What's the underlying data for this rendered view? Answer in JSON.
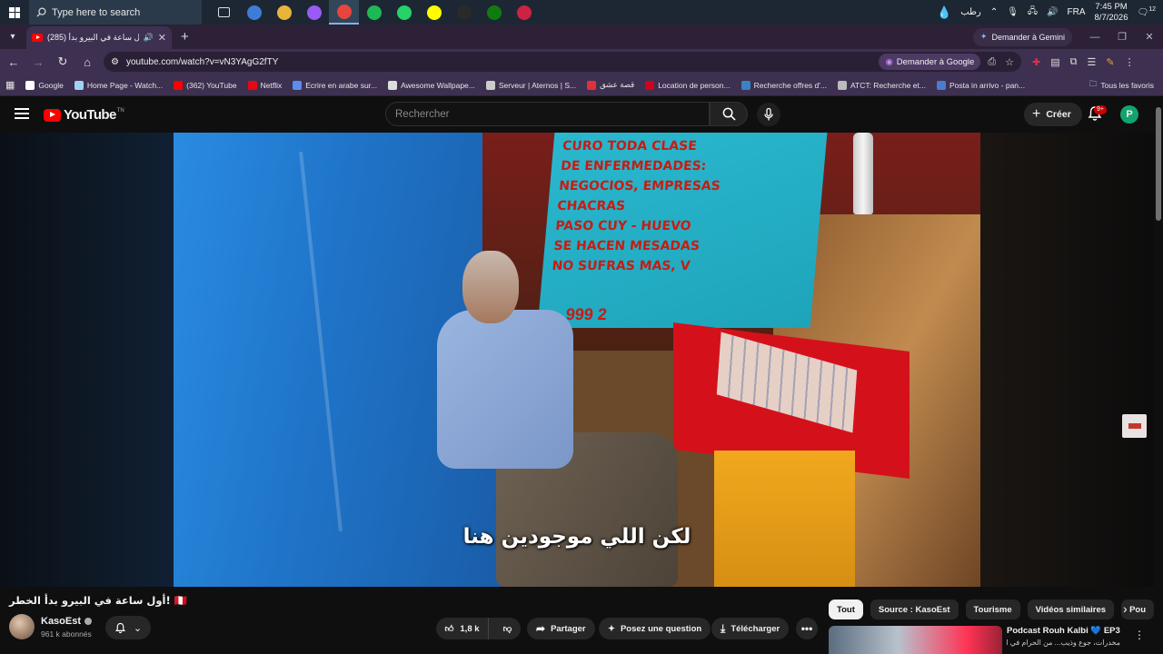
{
  "taskbar": {
    "search_placeholder": "Type here to search",
    "weather_text": "رطب",
    "language": "FRA",
    "time": "7:45 PM",
    "date": "8/7/2026",
    "notification_count": "12",
    "apps": [
      {
        "icon": "task-view-icon",
        "color": "#1d2733"
      },
      {
        "icon": "office-icon",
        "color": "#3d7dd8"
      },
      {
        "icon": "file-explorer-icon",
        "color": "#e8b43a"
      },
      {
        "icon": "messenger-icon",
        "color": "#9b59f5"
      },
      {
        "icon": "chrome-icon",
        "color": "#e8453c"
      },
      {
        "icon": "spotify-icon",
        "color": "#1db954"
      },
      {
        "icon": "whatsapp-icon",
        "color": "#25d366"
      },
      {
        "icon": "snapchat-icon",
        "color": "#fffc00"
      },
      {
        "icon": "chatgpt-icon",
        "color": "#2a2a2a"
      },
      {
        "icon": "xbox-icon",
        "color": "#107c10"
      },
      {
        "icon": "app-red-icon",
        "color": "#cc2244"
      }
    ]
  },
  "browser": {
    "tab_title": "(285) أول ساعة في البيرو بدأ",
    "gemini_label": "Demander à Gemini",
    "url": "youtube.com/watch?v=vN3YAgG2fTY",
    "ask_google_label": "Demander à Google",
    "bookmarks": [
      {
        "label": "Google",
        "color": "#ffffff"
      },
      {
        "label": "Home Page - Watch...",
        "color": "#9fd3f0"
      },
      {
        "label": "(362) YouTube",
        "color": "#ff0000"
      },
      {
        "label": "Netflix",
        "color": "#e50914"
      },
      {
        "label": "Ecrire en arabe sur...",
        "color": "#5a8dee"
      },
      {
        "label": "Awesome Wallpape...",
        "color": "#dddddd"
      },
      {
        "label": "Serveur | Aternos | S...",
        "color": "#cccccc"
      },
      {
        "label": "قصة عشق",
        "color": "#e0303a"
      },
      {
        "label": "Location de person...",
        "color": "#d0021b"
      },
      {
        "label": "Recherche offres d'...",
        "color": "#3b82c4"
      },
      {
        "label": "ATCT: Recherche et...",
        "color": "#bbbbbb"
      },
      {
        "label": "Posta in arrivo - pan...",
        "color": "#4a7bd0"
      }
    ],
    "all_bookmarks_label": "Tous les favoris"
  },
  "youtube": {
    "logo_text": "YouTube",
    "logo_region": "TN",
    "search_placeholder": "Rechercher",
    "create_label": "Créer",
    "notif_badge": "9+",
    "avatar_letter": "P"
  },
  "video": {
    "poster_lines": [
      "CURO TODA CLASE",
      "DE ENFERMEDADES:",
      "NEGOCIOS, EMPRESAS",
      "CHACRAS",
      "PASO CUY - HUEVO",
      "SE HACEN MESADAS",
      "NO SUFRAS MAS, V"
    ],
    "poster_number": "999 2",
    "subtitle": "لكن اللي موجودين هنا",
    "title": "أول ساعة في البيرو بدأ الخطر! 🇵🇪",
    "channel_name": "KasoEst",
    "subscribers": "961 k abonnés",
    "likes": "1,8 k",
    "share_label": "Partager",
    "ask_label": "Posez une question",
    "download_label": "Télécharger"
  },
  "sidebar": {
    "chips": [
      {
        "label": "Tout",
        "active": true
      },
      {
        "label": "Source : KasoEst",
        "active": false
      },
      {
        "label": "Tourisme",
        "active": false
      },
      {
        "label": "Vidéos similaires",
        "active": false
      },
      {
        "label": "Pou",
        "active": false
      }
    ],
    "recommended": {
      "title": "Podcast Rouh Kalbi 💙 EP3 |",
      "subtitle": "مخدرات، جوع وذيب... من الحرام في الغربة"
    }
  }
}
